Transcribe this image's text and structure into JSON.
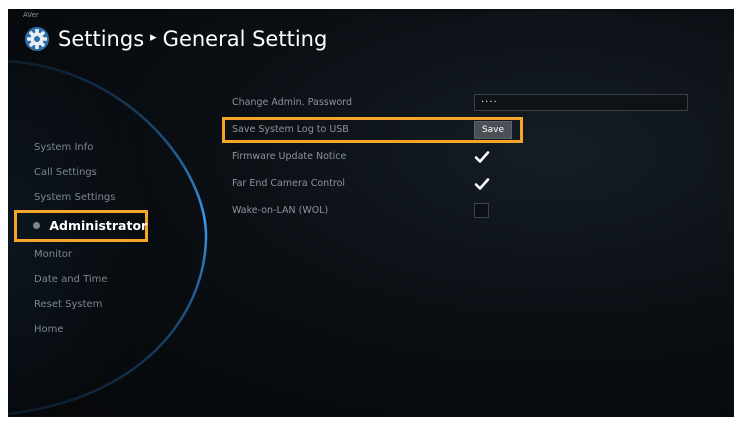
{
  "brand": "AVer",
  "header": {
    "title": "Settings",
    "separator": "▸",
    "subtitle": "General Setting",
    "icon": "gear-icon"
  },
  "sidebar": {
    "items": [
      {
        "label": "System Info",
        "active": false
      },
      {
        "label": "Call Settings",
        "active": false
      },
      {
        "label": "System Settings",
        "active": false
      },
      {
        "label": "Administrator",
        "active": true
      },
      {
        "label": "Monitor",
        "active": false
      },
      {
        "label": "Date and Time",
        "active": false
      },
      {
        "label": "Reset System",
        "active": false
      },
      {
        "label": "Home",
        "active": false
      }
    ]
  },
  "settings": {
    "change_password": {
      "label": "Change Admin. Password",
      "value": "····"
    },
    "save_log": {
      "label": "Save System Log to USB",
      "button": "Save"
    },
    "firmware_notice": {
      "label": "Firmware Update Notice",
      "checked": true
    },
    "far_end_camera": {
      "label": "Far End Camera Control",
      "checked": true
    },
    "wake_on_lan": {
      "label": "Wake-on-LAN (WOL)",
      "checked": false
    }
  },
  "colors": {
    "highlight": "#f4a52a",
    "background": "#0a0f14",
    "arc": "#2f86d8",
    "text_dim": "#7d858e"
  }
}
